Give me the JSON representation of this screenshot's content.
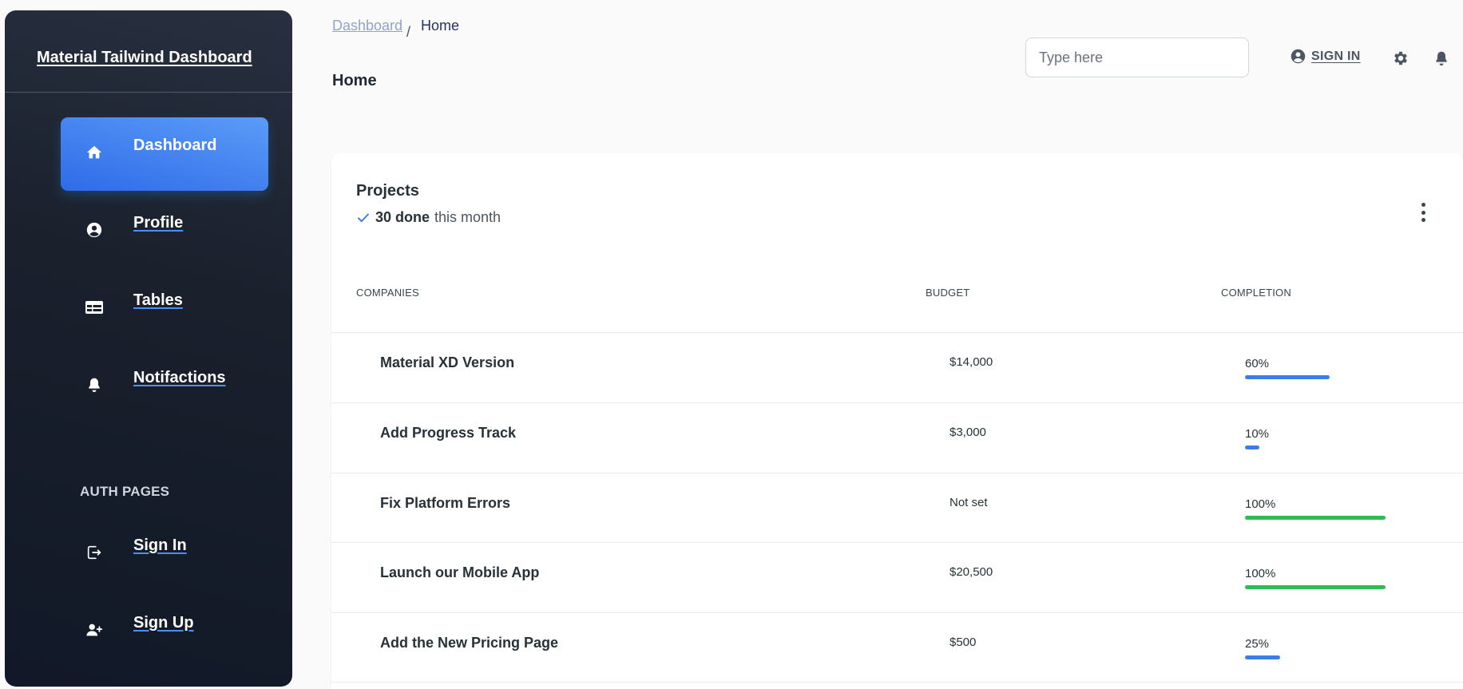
{
  "sidebar": {
    "brand": "Material Tailwind Dashboard",
    "nav": [
      {
        "label": "Dashboard",
        "icon": "home-icon",
        "active": true
      },
      {
        "label": "Profile",
        "icon": "user-circle-icon",
        "active": false
      },
      {
        "label": "Tables",
        "icon": "table-icon",
        "active": false
      },
      {
        "label": "Notifactions",
        "icon": "bell-icon",
        "active": false
      }
    ],
    "auth_heading": "AUTH PAGES",
    "auth_nav": [
      {
        "label": "Sign In",
        "icon": "sign-in-icon"
      },
      {
        "label": "Sign Up",
        "icon": "user-plus-icon"
      }
    ]
  },
  "header": {
    "breadcrumb": {
      "parent": "Dashboard",
      "separator": "/",
      "current": "Home"
    },
    "title": "Home",
    "search": {
      "placeholder": "Type here",
      "value": ""
    },
    "sign_in_label": "SIGN IN"
  },
  "projects": {
    "title": "Projects",
    "done_count": "30 done",
    "done_suffix": "this month",
    "columns": [
      "COMPANIES",
      "BUDGET",
      "COMPLETION"
    ],
    "rows": [
      {
        "company": "Material XD Version",
        "budget": "$14,000",
        "completion_label": "60%",
        "completion": 0.6,
        "color": "#3b7ded"
      },
      {
        "company": "Add Progress Track",
        "budget": "$3,000",
        "completion_label": "10%",
        "completion": 0.1,
        "color": "#3b7ded"
      },
      {
        "company": "Fix Platform Errors",
        "budget": "Not set",
        "completion_label": "100%",
        "completion": 1.0,
        "color": "#2ebc55"
      },
      {
        "company": "Launch our Mobile App",
        "budget": "$20,500",
        "completion_label": "100%",
        "completion": 1.0,
        "color": "#2ebc55"
      },
      {
        "company": "Add the New Pricing Page",
        "budget": "$500",
        "completion_label": "25%",
        "completion": 0.25,
        "color": "#3b7ded"
      }
    ]
  },
  "colors": {
    "accent_blue": "#3b7ded",
    "success_green": "#2ebc55",
    "sidebar_bg": "#1a202c"
  }
}
